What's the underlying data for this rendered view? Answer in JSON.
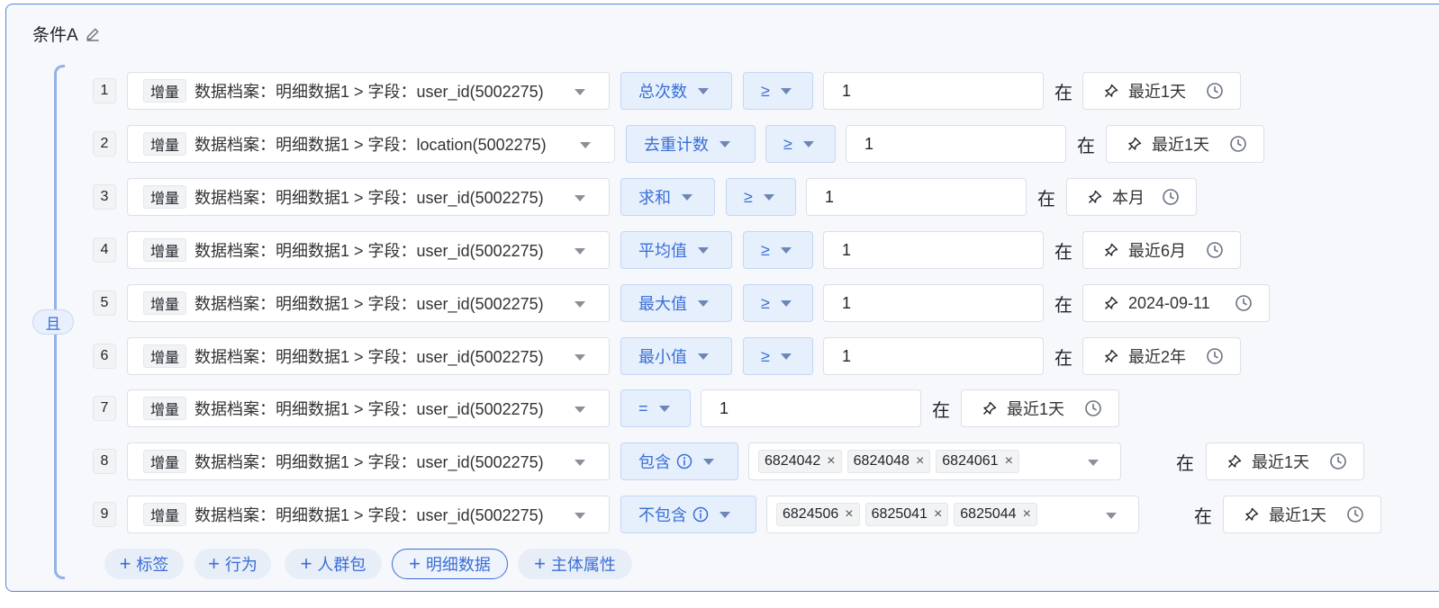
{
  "panel": {
    "title": "条件A",
    "logic": "且"
  },
  "rows": [
    {
      "num": "1",
      "tag": "增量",
      "field": "数据档案：明细数据1 > 字段：user_id(5002275)",
      "agg": "总次数",
      "op": "≥",
      "value": "1",
      "in": "在",
      "time": "最近1天"
    },
    {
      "num": "2",
      "tag": "增量",
      "field": "数据档案：明细数据1 > 字段：location(5002275)",
      "agg": "去重计数",
      "op": "≥",
      "value": "1",
      "in": "在",
      "time": "最近1天"
    },
    {
      "num": "3",
      "tag": "增量",
      "field": "数据档案：明细数据1 > 字段：user_id(5002275)",
      "agg": "求和",
      "op": "≥",
      "value": "1",
      "in": "在",
      "time": "本月"
    },
    {
      "num": "4",
      "tag": "增量",
      "field": "数据档案：明细数据1 > 字段：user_id(5002275)",
      "agg": "平均值",
      "op": "≥",
      "value": "1",
      "in": "在",
      "time": "最近6月"
    },
    {
      "num": "5",
      "tag": "增量",
      "field": "数据档案：明细数据1 > 字段：user_id(5002275)",
      "agg": "最大值",
      "op": "≥",
      "value": "1",
      "in": "在",
      "time": "2024-09-11"
    },
    {
      "num": "6",
      "tag": "增量",
      "field": "数据档案：明细数据1 > 字段：user_id(5002275)",
      "agg": "最小值",
      "op": "≥",
      "value": "1",
      "in": "在",
      "time": "最近2年"
    },
    {
      "num": "7",
      "tag": "增量",
      "field": "数据档案：明细数据1 > 字段：user_id(5002275)",
      "op": "=",
      "value": "1",
      "in": "在",
      "time": "最近1天"
    },
    {
      "num": "8",
      "tag": "增量",
      "field": "数据档案：明细数据1 > 字段：user_id(5002275)",
      "op": "包含",
      "chips": [
        "6824042",
        "6824048",
        "6824061"
      ],
      "in": "在",
      "time": "最近1天"
    },
    {
      "num": "9",
      "tag": "增量",
      "field": "数据档案：明细数据1 > 字段：user_id(5002275)",
      "op": "不包含",
      "chips": [
        "6824506",
        "6825041",
        "6825044"
      ],
      "in": "在",
      "time": "最近1天"
    }
  ],
  "add_buttons": [
    {
      "label": "标签"
    },
    {
      "label": "行为"
    },
    {
      "label": "人群包"
    },
    {
      "label": "明细数据"
    },
    {
      "label": "主体属性"
    }
  ],
  "icons": {
    "edit": "pencil-icon",
    "time_picker": "pin-icon",
    "clock": "clock-icon",
    "info": "info-icon",
    "dropdown": "caret-down-icon",
    "remove_chip": "close-icon",
    "add": "plus-icon"
  },
  "colors": {
    "accent": "#3a6ed6",
    "border": "#4f87e6"
  }
}
